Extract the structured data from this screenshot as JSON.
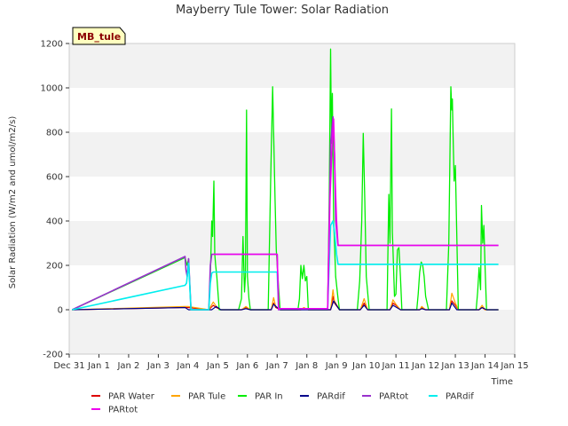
{
  "chart_data": {
    "type": "line",
    "title": "Mayberry Tule Tower: Solar Radiation",
    "badge": "MB_tule",
    "xlabel": "Time",
    "ylabel": "Solar Radiation (W/m2 and umol/m2/s)",
    "xlim": [
      0,
      15
    ],
    "ylim": [
      -200,
      1200
    ],
    "yticks": [
      -200,
      0,
      200,
      400,
      600,
      800,
      1000,
      1200
    ],
    "xticks": [
      0,
      1,
      2,
      3,
      4,
      5,
      6,
      7,
      8,
      9,
      10,
      11,
      12,
      13,
      14,
      15
    ],
    "xtick_labels": [
      "Dec 31",
      "Jan 1",
      "Jan 2",
      "Jan 3",
      "Jan 4",
      "Jan 5",
      "Jan 6",
      "Jan 7",
      "Jan 8",
      "Jan 9",
      "Jan 10",
      "Jan 11",
      "Jan 12",
      "Jan 13",
      "Jan 14",
      "Jan 15"
    ],
    "grid": "horizontal bands",
    "legend_position": "bottom",
    "series": [
      {
        "name": "PAR Water",
        "color": "#dd0000",
        "width": 1.2,
        "x": [
          0.1,
          3.9,
          4.0,
          4.7,
          4.85,
          4.95,
          5.1,
          5.8,
          5.95,
          6.1,
          6.8,
          6.88,
          6.95,
          7.1,
          7.8,
          7.9,
          8.05,
          8.8,
          8.88,
          8.93,
          9.1,
          9.8,
          9.93,
          10.05,
          10.8,
          10.9,
          11.0,
          11.15,
          11.8,
          11.87,
          12.0,
          12.1,
          12.8,
          12.88,
          13.0,
          13.1,
          13.8,
          13.9,
          14.0,
          14.1,
          14.45
        ],
        "y": [
          0,
          10,
          10,
          0,
          20,
          10,
          0,
          0,
          10,
          0,
          0,
          30,
          10,
          0,
          0,
          5,
          0,
          0,
          60,
          30,
          0,
          0,
          30,
          0,
          0,
          30,
          20,
          0,
          0,
          10,
          0,
          0,
          0,
          40,
          20,
          0,
          0,
          10,
          0,
          0,
          0
        ]
      },
      {
        "name": "PAR Tule",
        "color": "#ffa500",
        "width": 1.2,
        "x": [
          0.1,
          3.9,
          4.0,
          4.7,
          4.85,
          4.95,
          5.1,
          5.8,
          5.95,
          6.1,
          6.8,
          6.88,
          6.95,
          7.1,
          7.8,
          7.9,
          8.05,
          8.8,
          8.88,
          8.93,
          9.1,
          9.8,
          9.93,
          10.05,
          10.8,
          10.9,
          11.0,
          11.15,
          11.8,
          11.87,
          12.0,
          12.1,
          12.8,
          12.88,
          13.0,
          13.1,
          13.8,
          13.9,
          14.0,
          14.1,
          14.45
        ],
        "y": [
          0,
          15,
          15,
          0,
          35,
          15,
          0,
          0,
          15,
          0,
          0,
          55,
          15,
          0,
          0,
          10,
          0,
          0,
          90,
          40,
          0,
          0,
          50,
          0,
          0,
          45,
          25,
          0,
          0,
          15,
          0,
          0,
          0,
          75,
          30,
          0,
          0,
          20,
          0,
          0,
          0
        ]
      },
      {
        "name": "PAR In",
        "color": "#00ee00",
        "width": 1.3,
        "x": [
          0.1,
          3.9,
          3.97,
          4.02,
          4.1,
          4.7,
          4.75,
          4.8,
          4.83,
          4.87,
          4.9,
          4.93,
          4.97,
          5.05,
          5.7,
          5.8,
          5.85,
          5.9,
          5.93,
          5.97,
          6.0,
          6.05,
          6.1,
          6.7,
          6.78,
          6.85,
          6.88,
          6.93,
          6.97,
          7.05,
          7.1,
          7.7,
          7.75,
          7.8,
          7.85,
          7.9,
          7.95,
          8.0,
          8.05,
          8.7,
          8.75,
          8.8,
          8.83,
          8.86,
          8.9,
          8.93,
          8.97,
          9.05,
          9.1,
          9.7,
          9.78,
          9.85,
          9.9,
          9.95,
          10.0,
          10.1,
          10.7,
          10.76,
          10.8,
          10.85,
          10.88,
          10.9,
          10.95,
          11.0,
          11.05,
          11.1,
          11.15,
          11.2,
          11.7,
          11.75,
          11.8,
          11.85,
          11.9,
          11.95,
          12.0,
          12.1,
          12.7,
          12.78,
          12.85,
          12.88,
          12.9,
          12.93,
          12.96,
          13.0,
          13.1,
          13.7,
          13.75,
          13.8,
          13.85,
          13.88,
          13.92,
          13.96,
          14.0,
          14.05,
          14.45
        ],
        "y": [
          0,
          235,
          200,
          230,
          0,
          0,
          150,
          400,
          330,
          580,
          250,
          200,
          150,
          0,
          0,
          50,
          330,
          80,
          150,
          900,
          150,
          50,
          0,
          0,
          570,
          1005,
          800,
          500,
          270,
          100,
          0,
          0,
          50,
          200,
          140,
          200,
          130,
          150,
          0,
          0,
          450,
          1175,
          750,
          975,
          400,
          300,
          150,
          50,
          0,
          0,
          130,
          400,
          795,
          500,
          150,
          0,
          0,
          520,
          300,
          905,
          350,
          270,
          60,
          70,
          270,
          280,
          150,
          0,
          0,
          70,
          170,
          215,
          200,
          150,
          60,
          0,
          0,
          300,
          1005,
          900,
          950,
          750,
          580,
          650,
          0,
          0,
          80,
          190,
          90,
          470,
          300,
          380,
          200,
          0,
          0
        ]
      },
      {
        "name": "PARdif",
        "color": "#00008b",
        "width": 1.2,
        "x": [
          0.1,
          3.9,
          4.02,
          4.8,
          4.95,
          5.1,
          5.8,
          5.95,
          6.1,
          6.8,
          6.88,
          7.0,
          7.1,
          8.8,
          8.9,
          9.1,
          9.8,
          9.93,
          10.05,
          10.8,
          10.9,
          11.15,
          11.8,
          11.87,
          12.0,
          12.8,
          12.88,
          13.05,
          13.8,
          13.9,
          14.05,
          14.45
        ],
        "y": [
          0,
          10,
          0,
          0,
          15,
          0,
          0,
          5,
          0,
          0,
          25,
          10,
          0,
          0,
          40,
          0,
          0,
          20,
          0,
          0,
          20,
          0,
          0,
          5,
          0,
          0,
          30,
          0,
          0,
          10,
          0,
          0
        ]
      },
      {
        "name": "PARtot",
        "color": "#9932cc",
        "width": 1.6,
        "x": [
          0.1,
          3.9,
          3.93,
          3.97,
          4.02,
          4.1,
          4.7,
          4.75,
          4.8,
          4.85,
          7.0,
          7.05,
          7.1,
          8.7,
          8.8,
          8.88,
          8.93,
          8.97,
          9.05,
          14.45
        ],
        "y": [
          0,
          240,
          180,
          150,
          230,
          0,
          0,
          200,
          250,
          250,
          250,
          0,
          5,
          5,
          750,
          870,
          700,
          400,
          290,
          290
        ]
      },
      {
        "name": "PARdif",
        "color": "#00eeee",
        "width": 1.6,
        "x": [
          0.1,
          3.9,
          3.95,
          4.02,
          4.1,
          4.7,
          4.75,
          4.8,
          4.85,
          7.0,
          7.05,
          7.1,
          8.7,
          8.8,
          8.88,
          8.93,
          9.0,
          9.05,
          14.45
        ],
        "y": [
          0,
          110,
          120,
          210,
          0,
          0,
          120,
          165,
          170,
          170,
          0,
          5,
          5,
          380,
          400,
          350,
          250,
          205,
          205
        ]
      },
      {
        "name": "PARtot",
        "color": "#ee00ee",
        "width": 1.6,
        "x": [
          4.85,
          7.0,
          7.05,
          7.1,
          8.7,
          8.78,
          8.85,
          8.9,
          8.95,
          9.0,
          9.05,
          14.45
        ],
        "y": [
          250,
          250,
          0,
          5,
          5,
          500,
          750,
          860,
          600,
          400,
          290,
          290
        ]
      }
    ]
  }
}
